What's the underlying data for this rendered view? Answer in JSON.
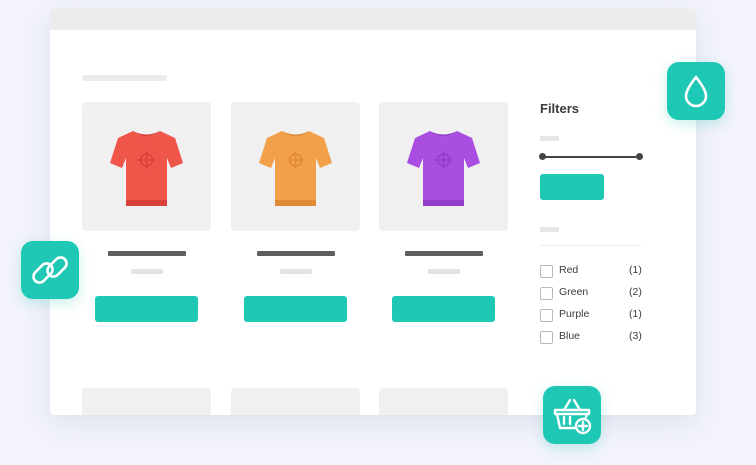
{
  "products": [
    {
      "color_name": "red",
      "shirt_color": "#ef5549",
      "shirt_dark": "#d8413a"
    },
    {
      "color_name": "orange",
      "shirt_color": "#f2a04a",
      "shirt_dark": "#e08a35"
    },
    {
      "color_name": "purple",
      "shirt_color": "#a94ee0",
      "shirt_dark": "#933bca"
    }
  ],
  "filters": {
    "title": "Filters",
    "colors": [
      {
        "label": "Red",
        "count": "(1)"
      },
      {
        "label": "Green",
        "count": "(2)"
      },
      {
        "label": "Purple",
        "count": "(1)"
      },
      {
        "label": "Blue",
        "count": "(3)"
      }
    ]
  },
  "badges": {
    "link_icon": "link-icon",
    "drop_icon": "water-drop-icon",
    "basket_icon": "basket-add-icon"
  },
  "accent_color": "#1ec8b5"
}
